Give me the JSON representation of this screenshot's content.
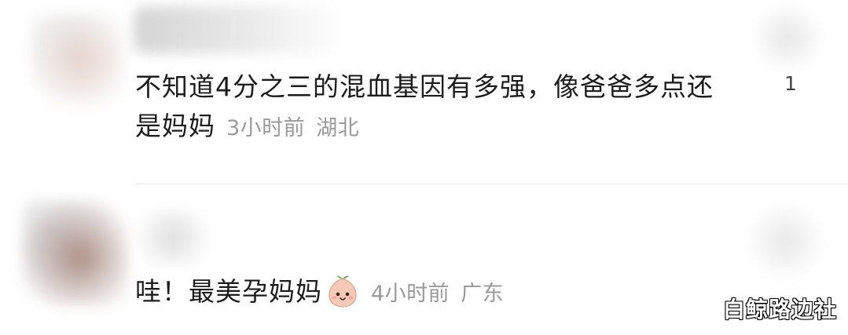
{
  "comments": [
    {
      "text": "不知道4分之三的混血基因有多强，像爸爸多点还是妈妈",
      "time": "3小时前",
      "location": "湖北",
      "likes": "1"
    },
    {
      "text": "哇！最美孕妈妈",
      "emoji": "peach-face-emoji-icon",
      "time": "4小时前",
      "location": "广东"
    }
  ],
  "watermark": "白鲸路边社"
}
